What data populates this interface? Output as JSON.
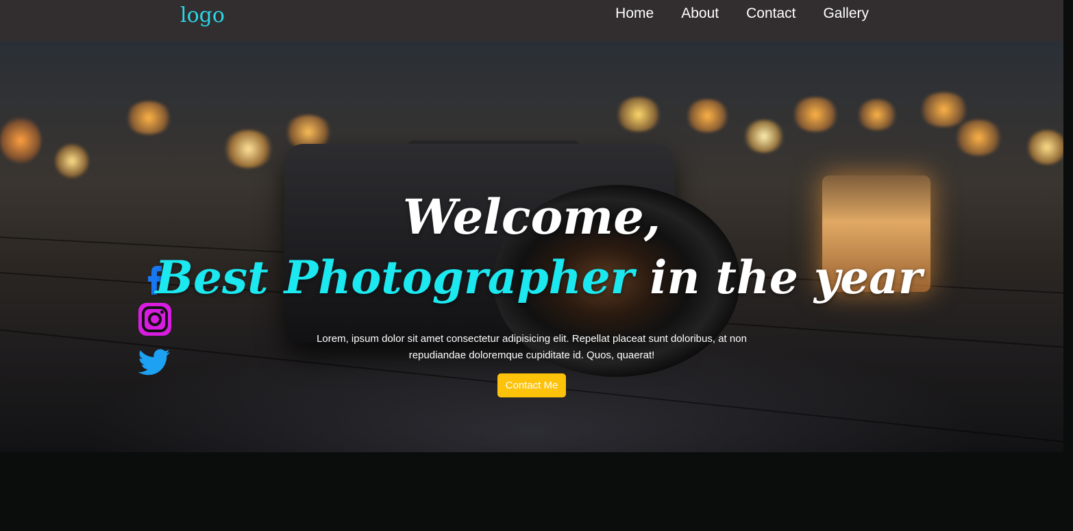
{
  "nav": {
    "logo": "logo",
    "links": [
      {
        "label": "Home"
      },
      {
        "label": "About"
      },
      {
        "label": "Contact"
      },
      {
        "label": "Gallery"
      }
    ]
  },
  "hero": {
    "welcome": "Welcome,",
    "headline_accent": "Best Photographer",
    "headline_rest": " in the year",
    "description": "Lorem, ipsum dolor sit amet consectetur adipisicing elit. Repellat placeat sunt doloribus, at non repudiandae doloremque cupiditate id. Quos, quaerat!",
    "cta_label": "Contact Me",
    "background_image": "camera-on-wooden-table-with-candles-bokeh"
  },
  "social": [
    {
      "icon": "facebook-icon",
      "color": "#1877f2"
    },
    {
      "icon": "instagram-icon",
      "color": "#d81ce0"
    },
    {
      "icon": "twitter-icon",
      "color": "#1da1f2"
    }
  ],
  "colors": {
    "navbar": "#322e2f",
    "logo": "#2ad7e6",
    "accent": "#1ce8f0",
    "button": "#fdc20a",
    "page_background": "#0b0c0c"
  }
}
